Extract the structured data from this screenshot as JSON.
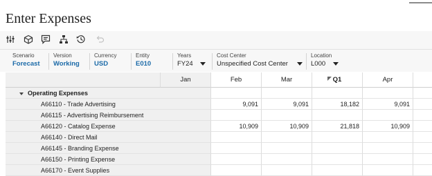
{
  "page": {
    "title": "Enter Expenses"
  },
  "toolbar": {
    "icons": [
      "sliders-icon",
      "cube-icon",
      "comment-icon",
      "hierarchy-icon",
      "history-icon",
      "undo-icon"
    ]
  },
  "pov": {
    "scenario": {
      "label": "Scenario",
      "value": "Forecast"
    },
    "version": {
      "label": "Version",
      "value": "Working"
    },
    "currency": {
      "label": "Currency",
      "value": "USD"
    },
    "entity": {
      "label": "Entity",
      "value": "E010"
    },
    "years": {
      "label": "Years",
      "value": "FY24"
    },
    "cost_center": {
      "label": "Cost Center",
      "value": "Unspecified Cost Center"
    },
    "location": {
      "label": "Location",
      "value": "L000"
    }
  },
  "grid": {
    "columns": [
      "Jan",
      "Feb",
      "Mar",
      "Q1",
      "Apr",
      "M"
    ],
    "rows": [
      {
        "label": "Operating Expenses",
        "values": [
          "",
          "",
          "",
          "",
          "",
          ""
        ]
      },
      {
        "label": "A66110 - Trade Advertising",
        "values": [
          "",
          "9,091",
          "9,091",
          "18,182",
          "9,091",
          ""
        ]
      },
      {
        "label": "A66115 - Advertising Reimbursement",
        "values": [
          "",
          "",
          "",
          "",
          "",
          ""
        ]
      },
      {
        "label": "A66120 - Catalog Expense",
        "values": [
          "",
          "10,909",
          "10,909",
          "21,818",
          "10,909",
          ""
        ]
      },
      {
        "label": "A66140 - Direct Mail",
        "values": [
          "",
          "",
          "",
          "",
          "",
          ""
        ]
      },
      {
        "label": "A66145 - Branding Expense",
        "values": [
          "",
          "",
          "",
          "",
          "",
          ""
        ]
      },
      {
        "label": "A66150 - Printing Expense",
        "values": [
          "",
          "",
          "",
          "",
          "",
          ""
        ]
      },
      {
        "label": "A66170 - Event Supplies",
        "values": [
          "",
          "",
          "",
          "",
          "",
          ""
        ]
      }
    ]
  }
}
